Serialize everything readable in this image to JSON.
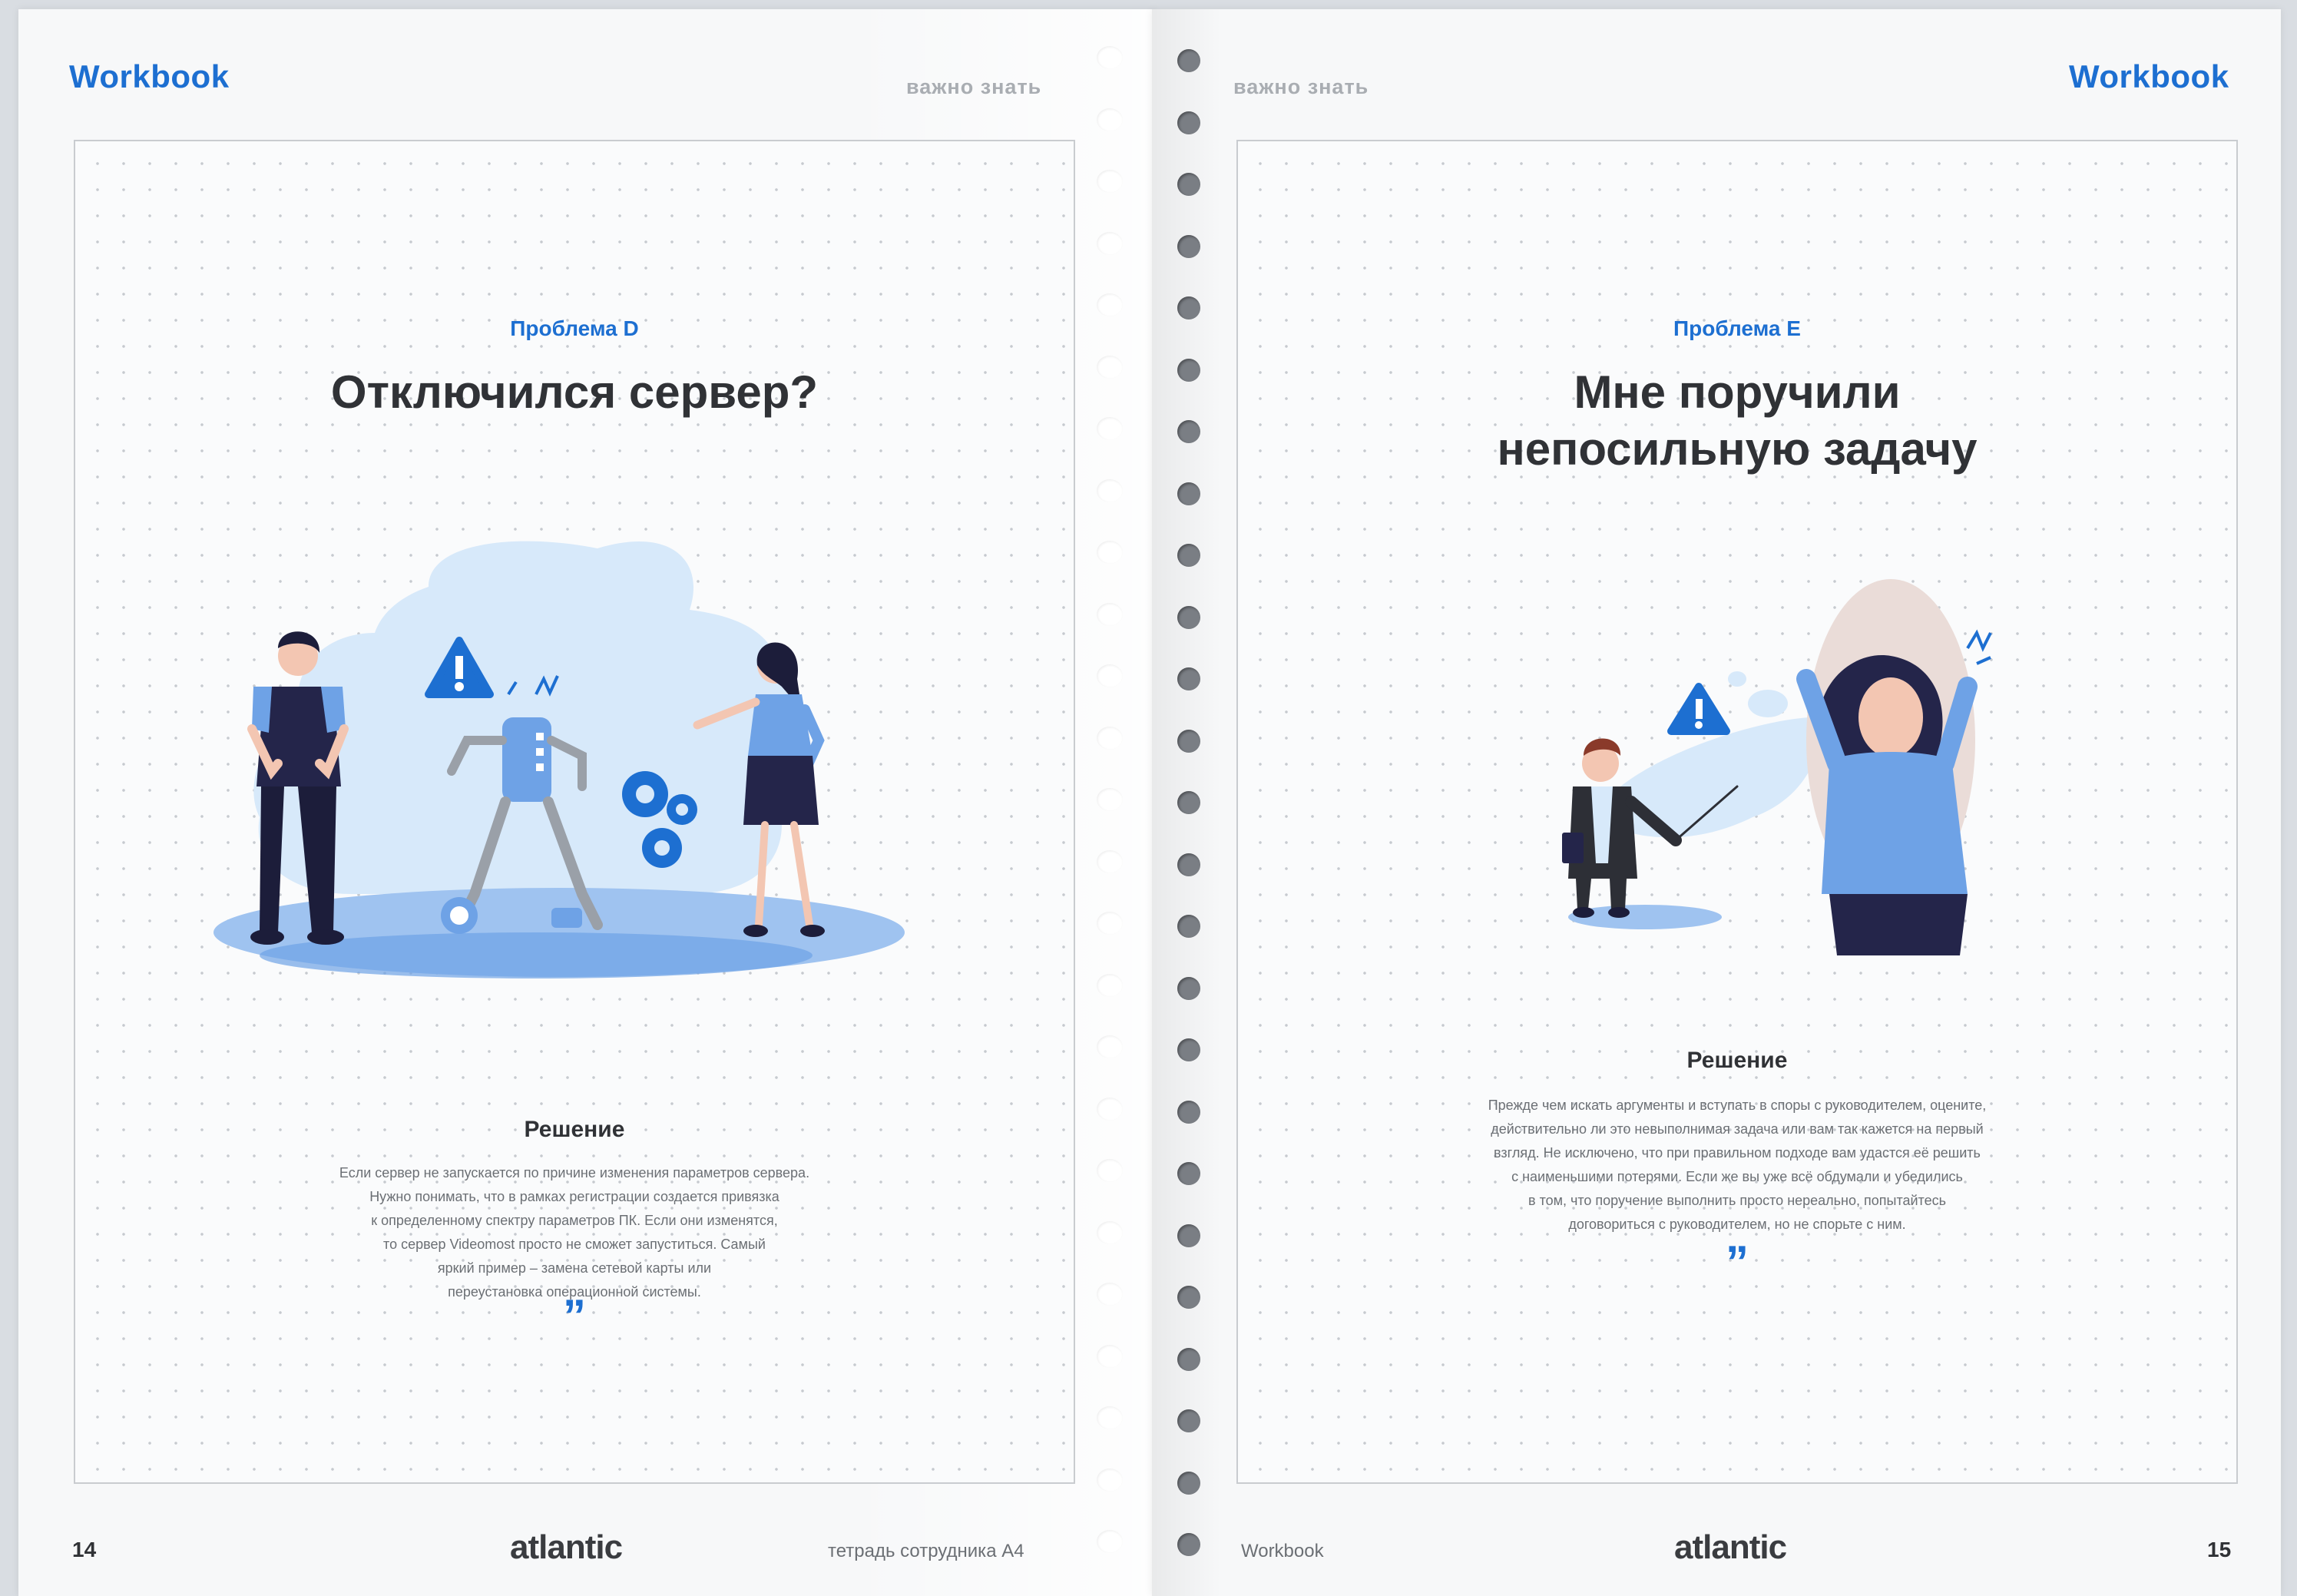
{
  "left_page": {
    "brand": "Workbook",
    "section": "важно знать",
    "problem_label": "Проблема D",
    "title": "Отключился сервер?",
    "solution_heading": "Решение",
    "solution_lines": [
      "Если сервер не запускается по причине изменения параметров сервера.",
      "Нужно понимать, что в рамках регистрации создается привязка",
      "к определенному спектру параметров ПК. Если они изменятся,",
      "то сервер Videomost просто не сможет запуститься. Самый",
      "яркий пример – замена сетевой карты или",
      "переустановка операционной системы."
    ],
    "quote_mark": "”",
    "page_number": "14",
    "logo": "atlantic",
    "footer_note": "тетрадь сотрудника А4"
  },
  "right_page": {
    "brand": "Workbook",
    "section": "важно знать",
    "problem_label": "Проблема E",
    "title_lines": [
      "Мне поручили",
      "непосильную задачу"
    ],
    "solution_heading": "Решение",
    "solution_lines": [
      "Прежде чем искать аргументы и вступать в споры с руководителем, оцените,",
      "действительно ли это невыполнимая задача или вам так кажется на первый",
      "взгляд. Не исключено, что при правильном подходе вам удастся её решить",
      "с наименьшими потерями. Если же вы уже всё обдумали и убедились",
      "в том, что поручение выполнить просто нереально, попытайтесь",
      "договориться с руководителем, но не спорьте с ним."
    ],
    "quote_mark": "”",
    "footer_note": "Workbook",
    "logo": "atlantic",
    "page_number": "15"
  },
  "colors": {
    "brand_blue": "#1d6fd1",
    "light_blue": "#d7e9fa",
    "mid_blue": "#6ea2e6",
    "navy": "#24254a",
    "text_dark": "#303236",
    "text_gray": "#6b6f74"
  }
}
